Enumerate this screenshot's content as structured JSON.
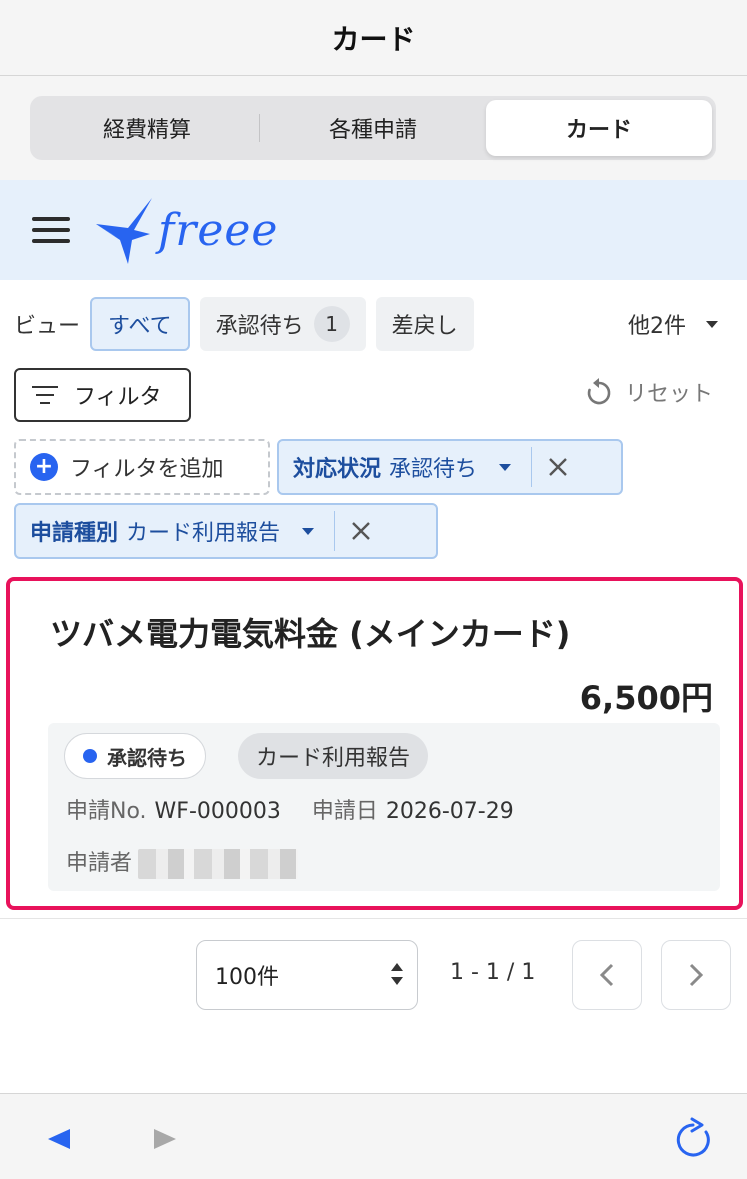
{
  "window": {
    "title": "カード"
  },
  "segments": [
    {
      "label": "経費精算",
      "active": false
    },
    {
      "label": "各種申請",
      "active": false
    },
    {
      "label": "カード",
      "active": true
    }
  ],
  "header": {
    "logo_text": "freee"
  },
  "views": {
    "label": "ビュー",
    "chips": [
      {
        "label": "すべて",
        "selected": true
      },
      {
        "label": "承認待ち",
        "count": "1",
        "selected": false
      },
      {
        "label": "差戻し",
        "selected": false
      }
    ],
    "more_label": "他2件"
  },
  "filter": {
    "button_label": "フィルタ",
    "reset_label": "リセット",
    "add_label": "フィルタを追加",
    "tags": [
      {
        "name": "対応状況",
        "value": "承認待ち"
      },
      {
        "name": "申請種別",
        "value": "カード利用報告"
      }
    ]
  },
  "card": {
    "title": "ツバメ電力電気料金 (メインカード)",
    "amount": "6,500円",
    "status": "承認待ち",
    "type": "カード利用報告",
    "app_no_label": "申請No.",
    "app_no": "WF-000003",
    "date_label": "申請日",
    "date": "2026-07-29",
    "applicant_label": "申請者"
  },
  "pagination": {
    "per_page": "100件",
    "range": "1 - 1 / 1"
  },
  "colors": {
    "accent": "#2864f0",
    "highlight_border": "#e8125b",
    "header_bg": "#e6f0fb"
  }
}
